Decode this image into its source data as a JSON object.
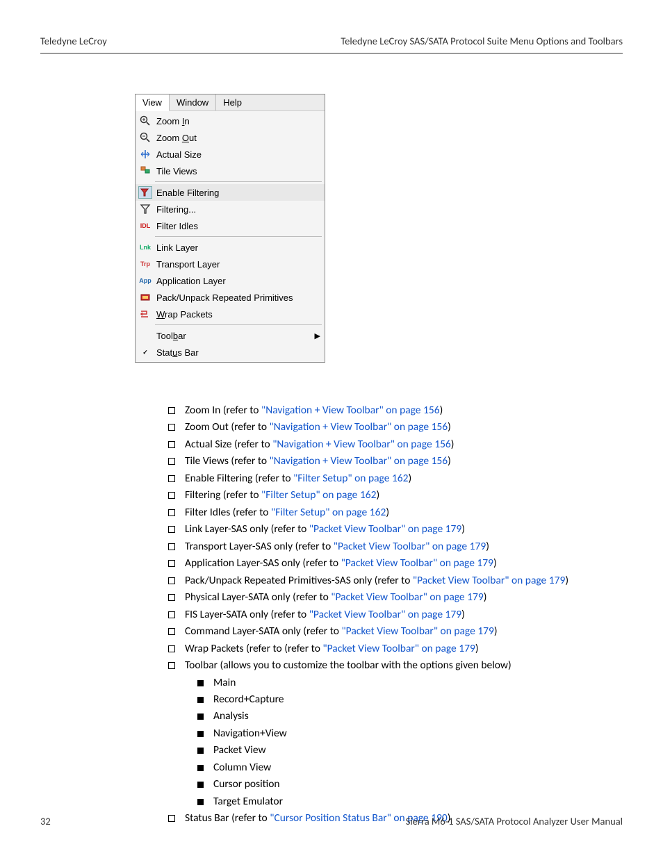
{
  "header": {
    "left": "Teledyne LeCroy",
    "right": "Teledyne LeCroy SAS/SATA Protocol Suite Menu Options and Toolbars"
  },
  "menu": {
    "tabs": [
      "View",
      "Window",
      "Help"
    ],
    "groups": [
      [
        {
          "icon": "zoom-in-icon",
          "label": "Zoom In",
          "name": "zoom-in-item"
        },
        {
          "icon": "zoom-out-icon",
          "label": "Zoom Out",
          "name": "zoom-out-item"
        },
        {
          "icon": "actual-size-icon",
          "label": "Actual Size",
          "name": "actual-size-item"
        },
        {
          "icon": "tile-views-icon",
          "label": "Tile Views",
          "name": "tile-views-item"
        }
      ],
      [
        {
          "icon": "enable-filtering-icon",
          "label": "Enable Filtering",
          "name": "enable-filtering-item",
          "selected": true
        },
        {
          "icon": "filtering-icon",
          "label": "Filtering...",
          "name": "filtering-item"
        },
        {
          "icon": "filter-idles-icon",
          "label": "Filter Idles",
          "name": "filter-idles-item"
        }
      ],
      [
        {
          "icon": "lnk-icon",
          "iconText": "Lnk",
          "iconColor": "#1a6",
          "label": "Link Layer",
          "name": "link-layer-item"
        },
        {
          "icon": "trp-icon",
          "iconText": "Trp",
          "iconColor": "#c33",
          "label": "Transport Layer",
          "name": "transport-layer-item"
        },
        {
          "icon": "app-icon",
          "iconText": "App",
          "iconColor": "#26a",
          "label": "Application Layer",
          "name": "application-layer-item"
        },
        {
          "icon": "pack-icon",
          "label": "Pack/Unpack Repeated Primitives",
          "name": "pack-unpack-item"
        },
        {
          "icon": "wrap-icon",
          "label": "Wrap Packets",
          "name": "wrap-packets-item"
        }
      ],
      [
        {
          "icon": "blank-icon",
          "label": "Toolbar",
          "name": "toolbar-submenu",
          "submenu": true
        },
        {
          "icon": "check-icon",
          "iconText": "✓",
          "label": "Status Bar",
          "name": "status-bar-item"
        }
      ]
    ]
  },
  "bullets": [
    {
      "pre": "Zoom In (refer to ",
      "link": "\"Navigation + View Toolbar\" on page 156",
      "post": ")"
    },
    {
      "pre": "Zoom Out (refer to ",
      "link": "\"Navigation + View Toolbar\" on page 156",
      "post": ")"
    },
    {
      "pre": "Actual Size (refer to ",
      "link": "\"Navigation + View Toolbar\" on page 156",
      "post": ")"
    },
    {
      "pre": "Tile Views (refer to ",
      "link": "\"Navigation + View Toolbar\" on page 156",
      "post": ")"
    },
    {
      "pre": "Enable Filtering (refer to ",
      "link": "\"Filter Setup\" on page 162",
      "post": ")"
    },
    {
      "pre": "Filtering (refer to ",
      "link": "\"Filter Setup\" on page 162",
      "post": ")"
    },
    {
      "pre": "Filter Idles (refer to ",
      "link": "\"Filter Setup\" on page 162",
      "post": ")"
    },
    {
      "pre": "Link Layer-SAS only (refer to ",
      "link": "\"Packet View Toolbar\" on page 179",
      "post": ")"
    },
    {
      "pre": "Transport Layer-SAS only (refer to ",
      "link": "\"Packet View Toolbar\" on page 179",
      "post": ")"
    },
    {
      "pre": "Application Layer-SAS only (refer to ",
      "link": "\"Packet View Toolbar\" on page 179",
      "post": ")"
    },
    {
      "pre": "Pack/Unpack Repeated Primitives-SAS only (refer to ",
      "link": "\"Packet View Toolbar\" on page 179",
      "post": ")"
    },
    {
      "pre": "Physical Layer-SATA only (refer to ",
      "link": "\"Packet View Toolbar\" on page 179",
      "post": ")"
    },
    {
      "pre": "FIS Layer-SATA only (refer to ",
      "link": "\"Packet View Toolbar\" on page 179",
      "post": ")"
    },
    {
      "pre": "Command Layer-SATA only (refer to ",
      "link": "\"Packet View Toolbar\" on page 179",
      "post": ")"
    },
    {
      "pre": "Wrap Packets (refer to (refer to ",
      "link": "\"Packet View Toolbar\" on page 179",
      "post": ")"
    },
    {
      "pre": "Toolbar (allows you to customize the toolbar with the options given below)",
      "link": "",
      "post": "",
      "sub": [
        "Main",
        "Record+Capture",
        "Analysis",
        "Navigation+View",
        "Packet View",
        "Column View",
        "Cursor position",
        "Target Emulator"
      ]
    },
    {
      "pre": "Status Bar (refer to ",
      "link": "\"Cursor Position Status Bar\" on page 190",
      "post": ")"
    }
  ],
  "footer": {
    "page": "32",
    "title": "Sierra M6-1 SAS/SATA Protocol Analyzer User Manual"
  }
}
